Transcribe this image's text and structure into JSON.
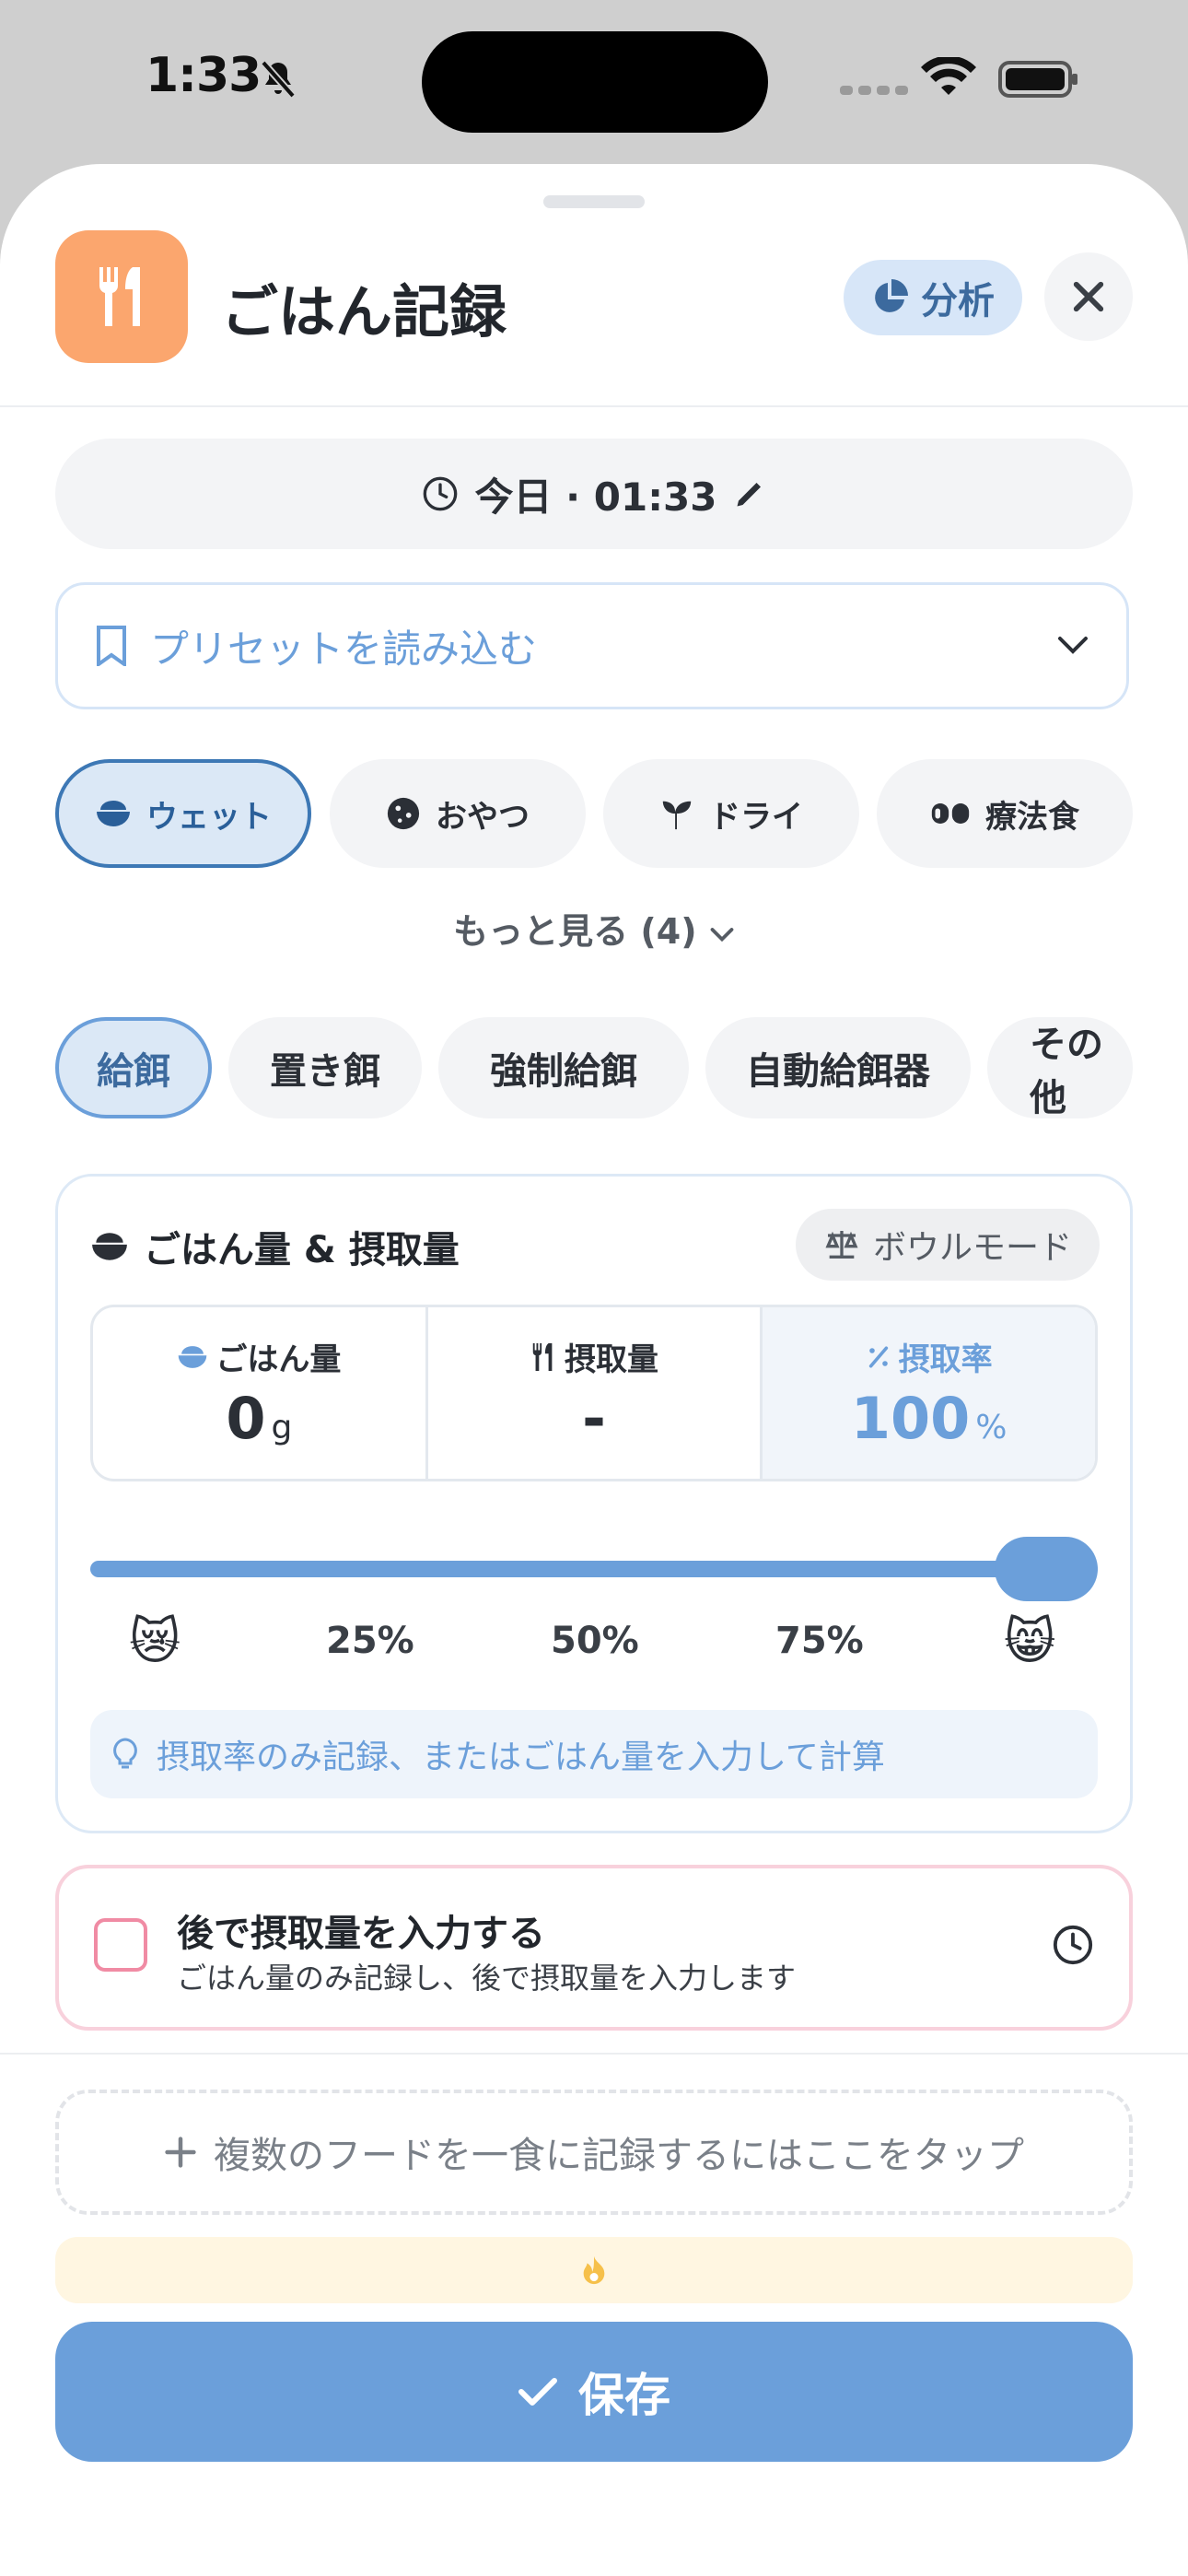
{
  "status_bar": {
    "time": "1:33"
  },
  "header": {
    "title": "ごはん記録",
    "analysis_label": "分析"
  },
  "datetime": {
    "label": "今日 · 01:33"
  },
  "preset": {
    "placeholder": "プリセットを読み込む"
  },
  "food_types": [
    {
      "label": "ウェット",
      "icon": "bowl-icon",
      "active": true
    },
    {
      "label": "おやつ",
      "icon": "cookie-icon",
      "active": false
    },
    {
      "label": "ドライ",
      "icon": "seedling-icon",
      "active": false
    },
    {
      "label": "療法食",
      "icon": "pills-icon",
      "active": false
    }
  ],
  "more_label": "もっと見る (4)",
  "feeding_methods": [
    {
      "label": "給餌",
      "active": true
    },
    {
      "label": "置き餌",
      "active": false
    },
    {
      "label": "強制給餌",
      "active": false
    },
    {
      "label": "自動給餌器",
      "active": false
    },
    {
      "label": "その他",
      "active": false
    }
  ],
  "amount_card": {
    "title": "ごはん量 & 摂取量",
    "bowl_mode_label": "ボウルモード",
    "food_amount": {
      "label": "ごはん量",
      "value": "0",
      "unit": "g"
    },
    "intake": {
      "label": "摂取量",
      "value": "-"
    },
    "rate": {
      "label": "摂取率",
      "value": "100",
      "unit": "%"
    },
    "slider_value_percent": 100,
    "ticks": [
      "25%",
      "50%",
      "75%"
    ],
    "emoji_low": "😿",
    "emoji_high": "😸",
    "hint": "摂取率のみ記録、またはごはん量を入力して計算"
  },
  "later": {
    "title": "後で摂取量を入力する",
    "subtitle": "ごはん量のみ記録し、後で摂取量を入力します",
    "checked": false
  },
  "add_multiple": "複数のフードを一食に記録するにはここをタップ",
  "save_label": "保存",
  "colors": {
    "accent": "#6b9fda",
    "app_icon": "#fba66e",
    "active_border": "#3d78b5",
    "later_border": "#f8d1dc"
  }
}
